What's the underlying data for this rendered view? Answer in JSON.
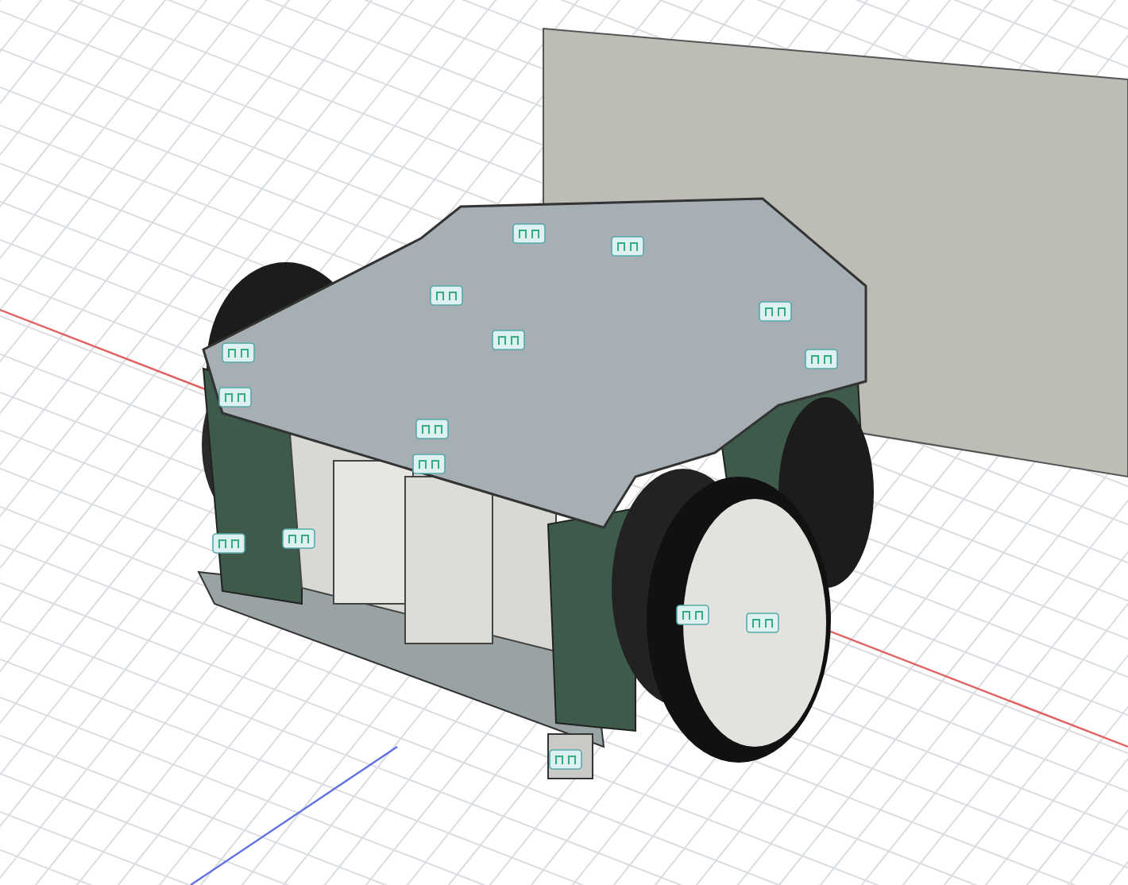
{
  "viewport": {
    "kind": "cad-3d"
  }
}
